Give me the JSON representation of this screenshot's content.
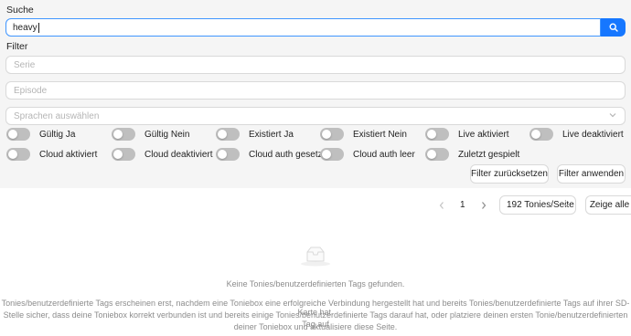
{
  "search": {
    "label": "Suche",
    "value": "heavy",
    "icon": "search-icon"
  },
  "filter": {
    "label": "Filter",
    "serie_placeholder": "Serie",
    "episode_placeholder": "Episode",
    "languages_placeholder": "Sprachen auswählen",
    "toggles_row1": [
      "Gültig Ja",
      "Gültig Nein",
      "Existiert Ja",
      "Existiert Nein",
      "Live aktiviert",
      "Live deaktiviert"
    ],
    "toggles_row2": [
      "Cloud aktiviert",
      "Cloud deaktiviert",
      "Cloud auth gesetzt",
      "Cloud auth leer",
      "Zuletzt gespielt"
    ],
    "reset_label": "Filter zurücksetzen",
    "apply_label": "Filter anwenden"
  },
  "pagination": {
    "current_page": "1",
    "page_size": "192 Tonies/Seite",
    "show_all_label": "Zeige alle"
  },
  "empty": {
    "title": "Keine Tonies/benutzerdefinierten Tags gefunden.",
    "line1": "Tonies/benutzerdefinierte Tags erscheinen erst, nachdem eine Toniebox eine erfolgreiche Verbindung hergestellt hat und bereits Tonies/benutzerdefinierte Tags auf ihrer SD-Karte hat.",
    "line2": "Stelle sicher, dass deine Toniebox korrekt verbunden ist und bereits einige Tonies/benutzerdefinierte Tags darauf hat, oder platziere deinen ersten Tonie/benutzerdefinierten Tag auf",
    "line3": "deiner Toniebox und aktualisiere diese Seite."
  },
  "colors": {
    "primary": "#1677ff",
    "panel": "#f5f5f5",
    "toggle_off": "#bfbfbf"
  }
}
